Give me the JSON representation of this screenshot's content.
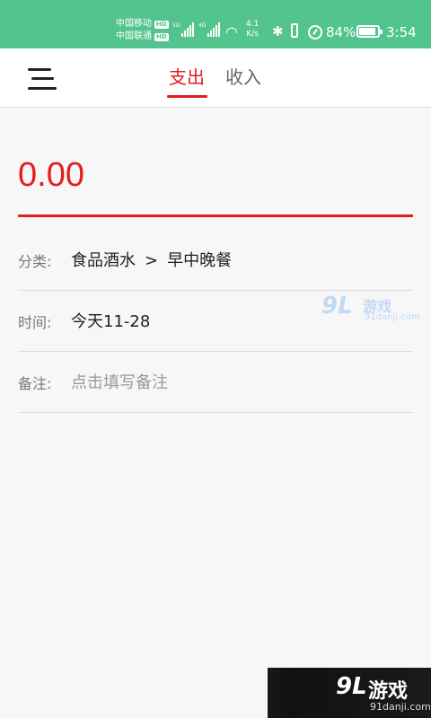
{
  "status_bar": {
    "carrier1": "中国移动",
    "carrier2": "中国联通",
    "hd": "HD",
    "net1": "5G",
    "net2": "4G",
    "speed_value": "4.1",
    "speed_unit": "K/s",
    "battery": "84%",
    "battery_level": 0.84,
    "time": "3:54",
    "icons": [
      "signal-icon",
      "wifi-icon",
      "bluetooth-icon",
      "vibrate-icon",
      "speedometer-icon",
      "battery-icon"
    ]
  },
  "header": {
    "menu_icon": "menu-icon",
    "tabs": [
      {
        "label": "支出",
        "active": true
      },
      {
        "label": "收入",
        "active": false
      }
    ]
  },
  "form": {
    "amount": "0.00",
    "category_label": "分类:",
    "category_main": "食品酒水",
    "category_sep": ">",
    "category_sub": "早中晚餐",
    "time_label": "时间:",
    "time_value": "今天11-28",
    "note_label": "备注:",
    "note_placeholder": "点击填写备注"
  },
  "watermark": {
    "logo": "9L",
    "name": "游戏",
    "domain": "91danji.com"
  },
  "colors": {
    "status_bar": "#54c48e",
    "accent": "#e21e1e",
    "background": "#f7f7f7"
  }
}
